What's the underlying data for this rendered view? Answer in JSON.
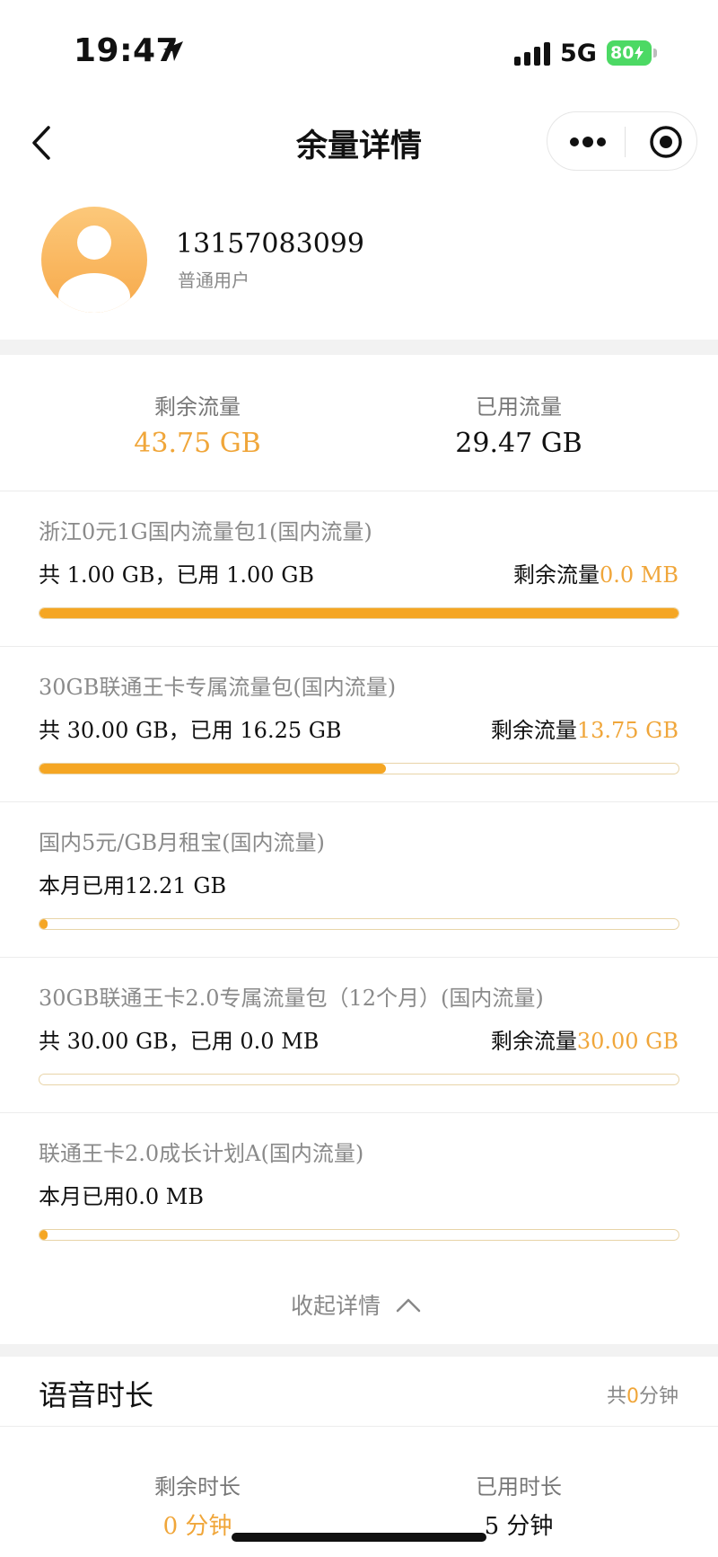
{
  "status_bar": {
    "time": "19:47",
    "network": "5G",
    "battery": "80"
  },
  "nav": {
    "title": "余量详情"
  },
  "user": {
    "phone": "13157083099",
    "type": "普通用户"
  },
  "data_summary": {
    "remaining_label": "剩余流量",
    "remaining_value": "43.75 GB",
    "used_label": "已用流量",
    "used_value": "29.47 GB"
  },
  "packages": [
    {
      "name": "浙江0元1G国内流量包1(国内流量)",
      "usage": "共 1.00 GB，已用 1.00 GB",
      "remain_label": "剩余流量",
      "remain_value": "0.0 MB",
      "progress": 1.0
    },
    {
      "name": "30GB联通王卡专属流量包(国内流量)",
      "usage": "共 30.00 GB，已用 16.25 GB",
      "remain_label": "剩余流量",
      "remain_value": "13.75 GB",
      "progress": 0.5417
    },
    {
      "name": "国内5元/GB月租宝(国内流量)",
      "usage": "本月已用12.21 GB",
      "remain_label": "",
      "remain_value": "",
      "progress": 0.012
    },
    {
      "name": "30GB联通王卡2.0专属流量包（12个月）(国内流量)",
      "usage": "共 30.00 GB，已用 0.0 MB",
      "remain_label": "剩余流量",
      "remain_value": "30.00 GB",
      "progress": 0.0
    },
    {
      "name": "联通王卡2.0成长计划A(国内流量)",
      "usage": "本月已用0.0 MB",
      "remain_label": "",
      "remain_value": "",
      "progress": 0.012
    }
  ],
  "collapse": {
    "label": "收起详情"
  },
  "voice": {
    "title": "语音时长",
    "total_prefix": "共",
    "total_value": "0",
    "total_suffix": "分钟",
    "remaining_label": "剩余时长",
    "remaining_value": "0 分钟",
    "used_label": "已用时长",
    "used_value": "5 分钟"
  },
  "colors": {
    "accent": "#f5a623",
    "accent_text": "#f0a63a",
    "battery": "#4cd964"
  }
}
